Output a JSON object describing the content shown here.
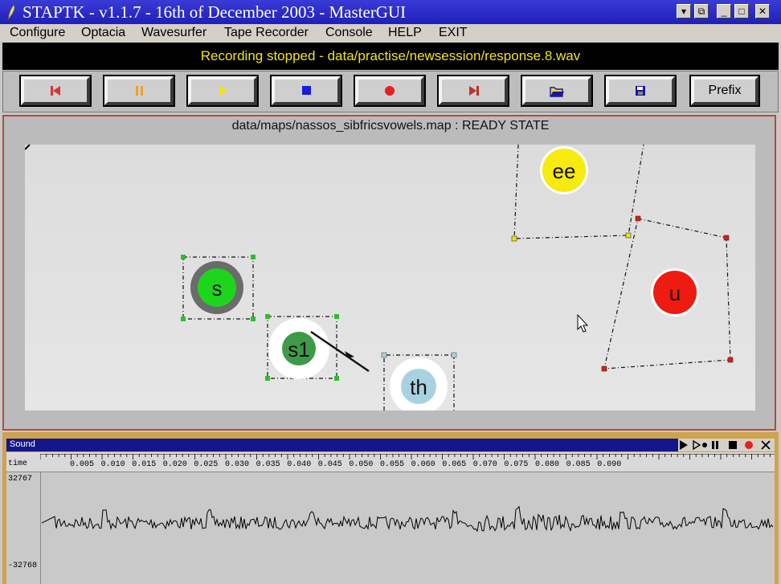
{
  "window": {
    "title": "STAPTK - v1.1.7 - 16th of December 2003 - MasterGUI",
    "controls": [
      "▾",
      "⧉",
      "_",
      "□",
      "✕"
    ]
  },
  "menu": [
    "Configure",
    "Optacia",
    "Wavesurfer",
    "Tape Recorder",
    "Console",
    "HELP",
    "EXIT"
  ],
  "status": "Recording stopped - data/practise/newsession/response.8.wav",
  "toolbar": {
    "buttons": [
      "rewind",
      "pause",
      "play",
      "stop",
      "record",
      "skip-end",
      "open",
      "save"
    ],
    "prefix_label": "Prefix",
    "colors": {
      "rewind": "#d93434",
      "pause": "#f0a020",
      "play": "#f6e300",
      "stop": "#1a1ae0",
      "record": "#e62020",
      "skip": "#c03030",
      "folder": "#1818a0",
      "save": "#1818a0"
    }
  },
  "map": {
    "title": "data/maps/nassos_sibfricsvowels.map : READY STATE",
    "nodes": [
      {
        "label": "ee",
        "color": "#f7ea0e"
      },
      {
        "label": "u",
        "color": "#ee1b10"
      },
      {
        "label": "s",
        "color": "#1ed51e"
      },
      {
        "label": "s1",
        "color": "#3e9a48"
      },
      {
        "label": "th",
        "color": "#a9d2e0"
      }
    ]
  },
  "sound": {
    "title": "Sound",
    "time_label": "time",
    "ticks": [
      "0.005",
      "0.010",
      "0.015",
      "0.020",
      "0.025",
      "0.030",
      "0.035",
      "0.040",
      "0.045",
      "0.050",
      "0.055",
      "0.060",
      "0.065",
      "0.070",
      "0.075",
      "0.080",
      "0.085",
      "0.090"
    ],
    "amp_max": "32767",
    "amp_min": "-32768"
  }
}
